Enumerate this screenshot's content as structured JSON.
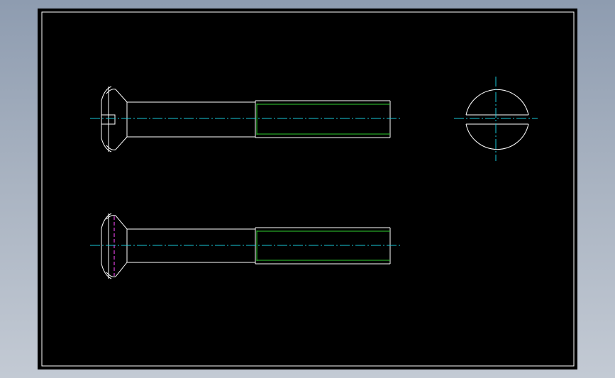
{
  "drawing": {
    "description_views": [
      "front-view-slotted",
      "front-view-rotated",
      "end-view"
    ],
    "colors": {
      "background": "#000000",
      "outline": "#ffffff",
      "thread": "#2fd02f",
      "centerline": "#18c9d8",
      "hidden": "#e040e0",
      "border": "#ffffff"
    }
  }
}
